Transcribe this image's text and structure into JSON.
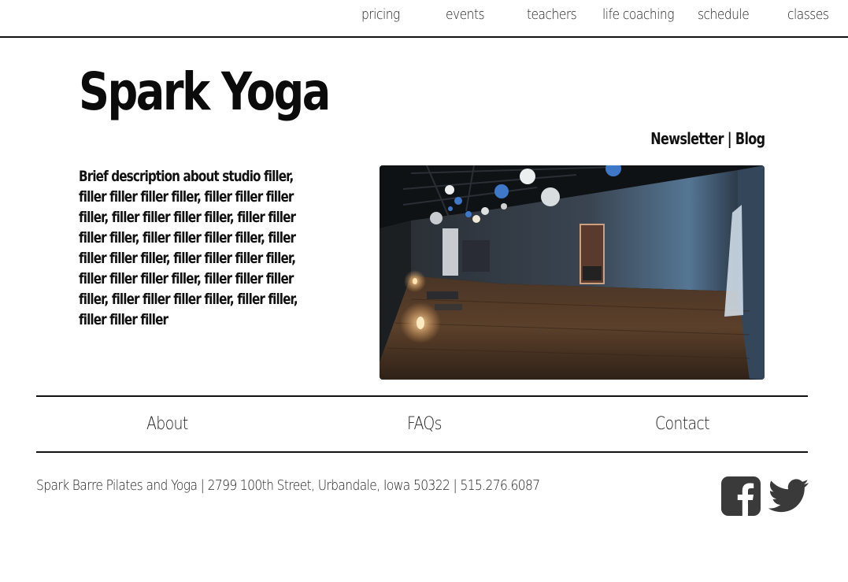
{
  "topnav": {
    "items": [
      "pricing",
      "events",
      "teachers",
      "life coaching",
      "schedule",
      "classes"
    ]
  },
  "header": {
    "title": "Spark Yoga",
    "newsletter": "Newsletter",
    "separator": "|",
    "blog": "Blog"
  },
  "main": {
    "description": "Brief description about studio filler, filler filler filler filler, filler filler filler filler, filler filler filler filler, filler filler filler filler, filler filler filler filler, filler filler filler filler, filler filler filler filler, filler filler filler filler, filler filler filler filler, filler filler filler filler, filler filler, filler filler filler",
    "photo_icon": "studio-photo"
  },
  "footer": {
    "links": [
      "About",
      "FAQs",
      "Contact"
    ],
    "address": "Spark Barre Pilates and Yoga | 2799 100th Street, Urbandale, Iowa 50322 | 515.276.6087",
    "social": [
      "facebook-icon",
      "twitter-icon"
    ],
    "icon_color": "#3a3a3a"
  }
}
